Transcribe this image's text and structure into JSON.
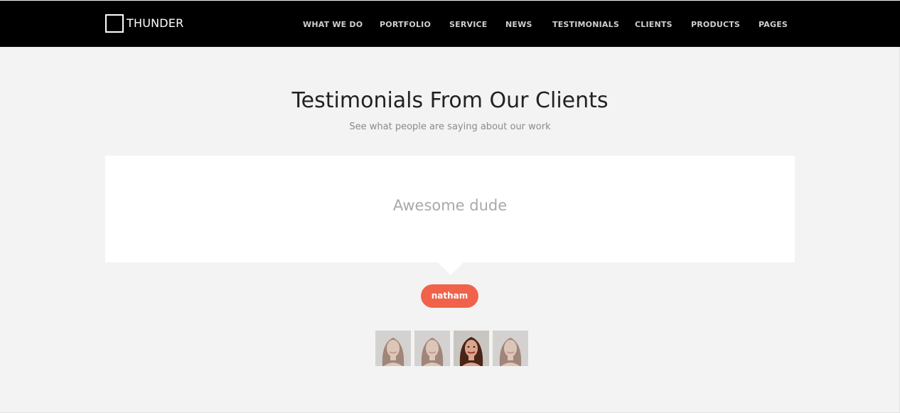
{
  "brand": {
    "name": "THUNDER"
  },
  "nav": {
    "items": [
      {
        "label": "WHAT WE DO"
      },
      {
        "label": "PORTFOLIO"
      },
      {
        "label": "SERVICE"
      },
      {
        "label": "NEWS"
      },
      {
        "label": "TESTIMONIALS"
      },
      {
        "label": "CLIENTS"
      },
      {
        "label": "PRODUCTS"
      },
      {
        "label": "PAGES"
      }
    ]
  },
  "section": {
    "title": "Testimonials From Our Clients",
    "subtitle": "See what people are saying about our work"
  },
  "testimonial": {
    "quote": "Awesome dude",
    "author": "natham"
  },
  "thumbnails": {
    "count": 4,
    "active_index": 2
  },
  "colors": {
    "nav_bg": "#000000",
    "page_bg": "#f3f3f3",
    "accent": "#f0634a",
    "active_indicator": "#27a9e1"
  }
}
